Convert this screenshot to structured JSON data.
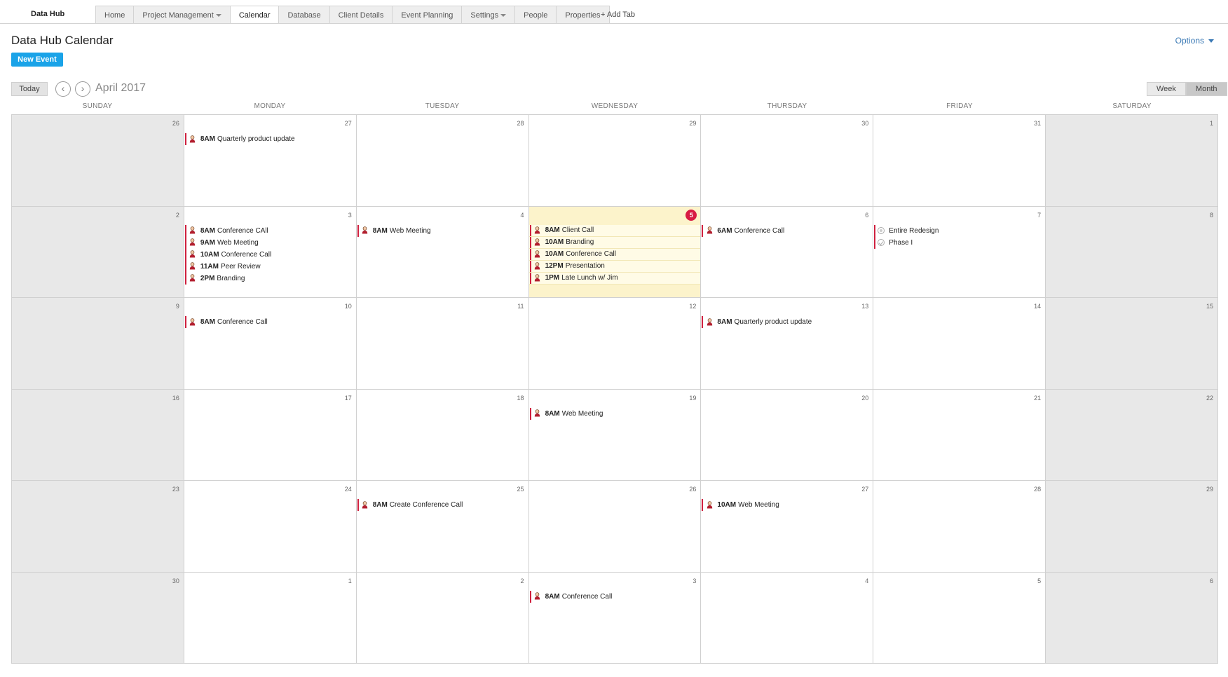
{
  "app": {
    "brand": "Data Hub"
  },
  "tabs": [
    {
      "label": "Home",
      "dropdown": false,
      "active": false
    },
    {
      "label": "Project Management",
      "dropdown": true,
      "active": false
    },
    {
      "label": "Calendar",
      "dropdown": false,
      "active": true
    },
    {
      "label": "Database",
      "dropdown": false,
      "active": false
    },
    {
      "label": "Client Details",
      "dropdown": false,
      "active": false
    },
    {
      "label": "Event Planning",
      "dropdown": false,
      "active": false
    },
    {
      "label": "Settings",
      "dropdown": true,
      "active": false
    },
    {
      "label": "People",
      "dropdown": false,
      "active": false
    },
    {
      "label": "Properties",
      "dropdown": false,
      "active": false
    }
  ],
  "add_tab_label": "+ Add Tab",
  "page": {
    "title": "Data Hub Calendar",
    "options_label": "Options",
    "new_event_label": "New Event"
  },
  "calendar": {
    "today_label": "Today",
    "month_label": "April 2017",
    "views": [
      {
        "label": "Week",
        "active": false
      },
      {
        "label": "Month",
        "active": true
      }
    ],
    "weekdays": [
      "SUNDAY",
      "MONDAY",
      "TUESDAY",
      "WEDNESDAY",
      "THURSDAY",
      "FRIDAY",
      "SATURDAY"
    ],
    "colors": {
      "event_bar": "#d0213f",
      "today_bg": "#fcf3cb",
      "today_badge": "#d81b43",
      "weekend_bg": "#e8e8e8",
      "accent": "#1aa3e8"
    },
    "weeks": [
      [
        {
          "day": "26",
          "events": []
        },
        {
          "day": "27",
          "events": [
            {
              "time": "8AM",
              "title": "Quarterly product update",
              "icon": "person-icon"
            }
          ]
        },
        {
          "day": "28",
          "events": []
        },
        {
          "day": "29",
          "events": []
        },
        {
          "day": "30",
          "events": []
        },
        {
          "day": "31",
          "events": []
        },
        {
          "day": "1",
          "events": []
        }
      ],
      [
        {
          "day": "2",
          "events": []
        },
        {
          "day": "3",
          "events": [
            {
              "time": "8AM",
              "title": "Conference CAll",
              "icon": "person-icon"
            },
            {
              "time": "9AM",
              "title": "Web Meeting",
              "icon": "person-icon"
            },
            {
              "time": "10AM",
              "title": "Conference Call",
              "icon": "person-icon"
            },
            {
              "time": "11AM",
              "title": "Peer Review",
              "icon": "person-icon"
            },
            {
              "time": "2PM",
              "title": "Branding",
              "icon": "person-icon"
            }
          ]
        },
        {
          "day": "4",
          "events": [
            {
              "time": "8AM",
              "title": "Web Meeting",
              "icon": "person-icon"
            }
          ]
        },
        {
          "day": "5",
          "today": true,
          "events": [
            {
              "time": "8AM",
              "title": "Client Call",
              "icon": "person-icon"
            },
            {
              "time": "10AM",
              "title": "Branding",
              "icon": "person-icon"
            },
            {
              "time": "10AM",
              "title": "Conference Call",
              "icon": "person-icon"
            },
            {
              "time": "12PM",
              "title": "Presentation",
              "icon": "person-icon"
            },
            {
              "time": "1PM",
              "title": "Late Lunch w/ Jim",
              "icon": "person-icon"
            }
          ]
        },
        {
          "day": "6",
          "events": [
            {
              "time": "6AM",
              "title": "Conference Call",
              "icon": "person-icon"
            }
          ]
        },
        {
          "day": "7",
          "events": [
            {
              "time": "",
              "title": "Entire Redesign",
              "icon": "task-icon"
            },
            {
              "time": "",
              "title": "Phase I",
              "icon": "task-check-icon"
            }
          ]
        },
        {
          "day": "8",
          "events": []
        }
      ],
      [
        {
          "day": "9",
          "events": []
        },
        {
          "day": "10",
          "events": [
            {
              "time": "8AM",
              "title": "Conference Call",
              "icon": "person-icon"
            }
          ]
        },
        {
          "day": "11",
          "events": []
        },
        {
          "day": "12",
          "events": []
        },
        {
          "day": "13",
          "events": [
            {
              "time": "8AM",
              "title": "Quarterly product update",
              "icon": "person-icon"
            }
          ]
        },
        {
          "day": "14",
          "events": []
        },
        {
          "day": "15",
          "events": []
        }
      ],
      [
        {
          "day": "16",
          "events": []
        },
        {
          "day": "17",
          "events": []
        },
        {
          "day": "18",
          "events": []
        },
        {
          "day": "19",
          "events": [
            {
              "time": "8AM",
              "title": "Web Meeting",
              "icon": "person-icon"
            }
          ]
        },
        {
          "day": "20",
          "events": []
        },
        {
          "day": "21",
          "events": []
        },
        {
          "day": "22",
          "events": []
        }
      ],
      [
        {
          "day": "23",
          "events": []
        },
        {
          "day": "24",
          "events": []
        },
        {
          "day": "25",
          "events": [
            {
              "time": "8AM",
              "title": "Create Conference Call",
              "icon": "person-icon"
            }
          ]
        },
        {
          "day": "26",
          "events": []
        },
        {
          "day": "27",
          "events": [
            {
              "time": "10AM",
              "title": "Web Meeting",
              "icon": "person-icon"
            }
          ]
        },
        {
          "day": "28",
          "events": []
        },
        {
          "day": "29",
          "events": []
        }
      ],
      [
        {
          "day": "30",
          "events": []
        },
        {
          "day": "1",
          "events": []
        },
        {
          "day": "2",
          "events": []
        },
        {
          "day": "3",
          "events": [
            {
              "time": "8AM",
              "title": "Conference Call",
              "icon": "person-icon"
            }
          ]
        },
        {
          "day": "4",
          "events": []
        },
        {
          "day": "5",
          "events": []
        },
        {
          "day": "6",
          "events": []
        }
      ]
    ]
  }
}
